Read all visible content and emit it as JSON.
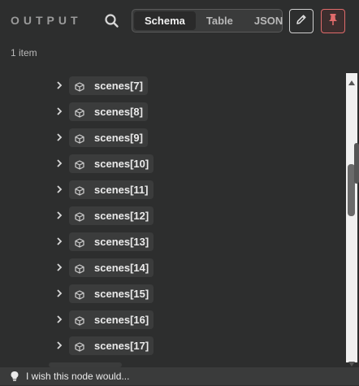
{
  "header": {
    "title": "OUTPUT",
    "search_icon": "search-icon",
    "views": [
      {
        "label": "Schema",
        "active": true
      },
      {
        "label": "Table",
        "active": false
      },
      {
        "label": "JSON",
        "active": false
      }
    ],
    "edit_icon": "pencil-icon",
    "pin_icon": "pin-icon"
  },
  "summary": {
    "count": "1 item"
  },
  "list": {
    "items": [
      {
        "label": "scenes[7]"
      },
      {
        "label": "scenes[8]"
      },
      {
        "label": "scenes[9]"
      },
      {
        "label": "scenes[10]"
      },
      {
        "label": "scenes[11]"
      },
      {
        "label": "scenes[12]"
      },
      {
        "label": "scenes[13]"
      },
      {
        "label": "scenes[14]"
      },
      {
        "label": "scenes[15]"
      },
      {
        "label": "scenes[16]"
      },
      {
        "label": "scenes[17]"
      }
    ]
  },
  "footer": {
    "text": "I wish this node would...",
    "icon": "lightbulb-icon"
  },
  "colors": {
    "background": "#2d2e2e",
    "pin_accent": "#e06b6b",
    "pill": "#3b3c3c"
  }
}
